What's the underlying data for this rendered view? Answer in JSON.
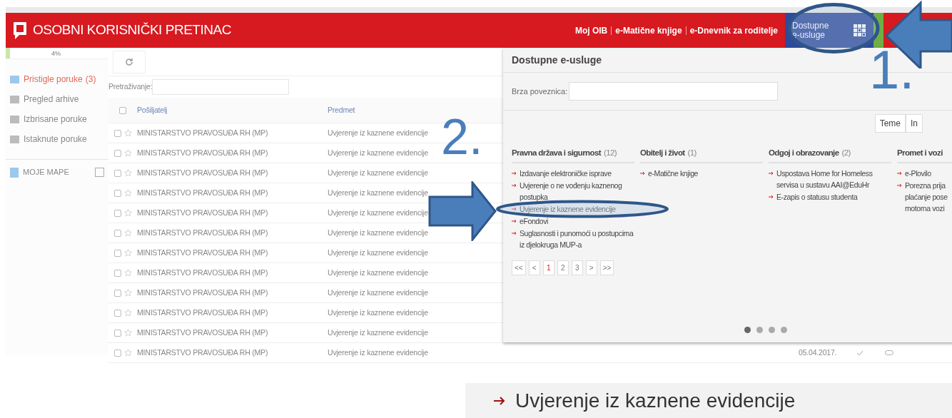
{
  "header": {
    "title": "OSOBNI KORISNIČKI PRETINAC",
    "links": [
      "Moj OIB",
      "e-Matične knjige",
      "e-Dnevnik za roditelje"
    ],
    "services_button": "Dostupne e-usluge"
  },
  "sidebar": {
    "quota": {
      "label": "4%",
      "level": 0.04
    },
    "items": [
      {
        "label": "Pristigle poruke",
        "count": "(3)",
        "selected": true
      },
      {
        "label": "Pregled arhive",
        "selected": false
      },
      {
        "label": "Izbrisane poruke",
        "selected": false
      },
      {
        "label": "Istaknute poruke",
        "selected": false
      }
    ],
    "folders": "MOJE MAPE"
  },
  "inbox": {
    "search_label": "Pretraživanje:",
    "select_all_checked": false,
    "columns": [
      "Pošiljatelj",
      "Predmet"
    ],
    "rows": [
      {
        "sender": "MINISTARSTVO PRAVOSUĐA RH (MP)",
        "subject": "Uvjerenje iz kaznene evidencije",
        "checked": false
      },
      {
        "sender": "MINISTARSTVO PRAVOSUĐA RH (MP)",
        "subject": "Uvjerenje iz kaznene evidencije",
        "checked": false
      },
      {
        "sender": "MINISTARSTVO PRAVOSUĐA RH (MP)",
        "subject": "Uvjerenje iz kaznene evidencije",
        "checked": false
      },
      {
        "sender": "MINISTARSTVO PRAVOSUĐA RH (MP)",
        "subject": "Uvjerenje iz kaznene evidencije",
        "checked": false
      },
      {
        "sender": "MINISTARSTVO PRAVOSUĐA RH (MP)",
        "subject": "Uvjerenje iz kaznene evidencije",
        "checked": false
      },
      {
        "sender": "MINISTARSTVO PRAVOSUĐA RH (MP)",
        "subject": "Uvjerenje iz kaznene evidencije",
        "checked": false
      },
      {
        "sender": "MINISTARSTVO PRAVOSUĐA RH (MP)",
        "subject": "Uvjerenje iz kaznene evidencije",
        "checked": false
      },
      {
        "sender": "MINISTARSTVO PRAVOSUĐA RH (MP)",
        "subject": "Uvjerenje iz kaznene evidencije",
        "checked": false
      },
      {
        "sender": "MINISTARSTVO PRAVOSUĐA RH (MP)",
        "subject": "Uvjerenje iz kaznene evidencije",
        "checked": false
      },
      {
        "sender": "MINISTARSTVO PRAVOSUĐA RH (MP)",
        "subject": "Uvjerenje iz kaznene evidencije",
        "checked": false
      },
      {
        "sender": "MINISTARSTVO PRAVOSUĐA RH (MP)",
        "subject": "Uvjerenje iz kaznene evidencije",
        "checked": false
      },
      {
        "sender": "MINISTARSTVO PRAVOSUĐA RH (MP)",
        "subject": "Uvjerenje iz kaznene evidencije",
        "checked": false,
        "date": "05.04.2017."
      }
    ]
  },
  "services_panel": {
    "title": "Dostupne e-usluge",
    "quick_link_label": "Brza poveznica:",
    "view_tabs": [
      "Teme",
      "In"
    ],
    "categories": [
      {
        "name": "Pravna država i sigurnost",
        "count": "(12)",
        "items": [
          {
            "text": "Izdavanje elektroničke isprave"
          },
          {
            "text": "Uvjerenje o ne vođenju kaznenog postupka"
          },
          {
            "text": "Uvjerenje iz kaznene evidencije"
          },
          {
            "text": "eFondovi"
          },
          {
            "text": "Suglasnosti i punomoći u postupcima iz djelokruga MUP-a"
          }
        ]
      },
      {
        "name": "Obitelj i život",
        "count": "(1)",
        "items": [
          {
            "text": "e-Matične knjige"
          }
        ]
      },
      {
        "name": "Odgoj i obrazovanje",
        "count": "(2)",
        "items": [
          {
            "text": "Uspostava Home for Homeless servisa u sustavu AAI@EduHr"
          },
          {
            "text": "E-zapis o statusu studenta"
          }
        ]
      },
      {
        "name": "Promet i vozi",
        "items": [
          {
            "text": "e-Plovilo"
          },
          {
            "lines": [
              "Porezna prija",
              "plaćanje pose",
              "motorna vozi"
            ]
          }
        ]
      }
    ],
    "pagination": [
      {
        "label": "<<",
        "selected": false
      },
      {
        "label": "<",
        "selected": false
      },
      {
        "label": "1",
        "selected": true
      },
      {
        "label": "2",
        "selected": false
      },
      {
        "label": "3",
        "selected": false
      },
      {
        "label": ">",
        "selected": false
      },
      {
        "label": ">>",
        "selected": false
      }
    ],
    "carousel_dots": [
      {
        "selected": true
      },
      {
        "selected": false
      },
      {
        "selected": false
      },
      {
        "selected": false
      }
    ]
  },
  "annotations": {
    "step_one": "1.",
    "step_two": "2.",
    "zoomed_link": "Uvjerenje iz kaznene evidencije"
  }
}
